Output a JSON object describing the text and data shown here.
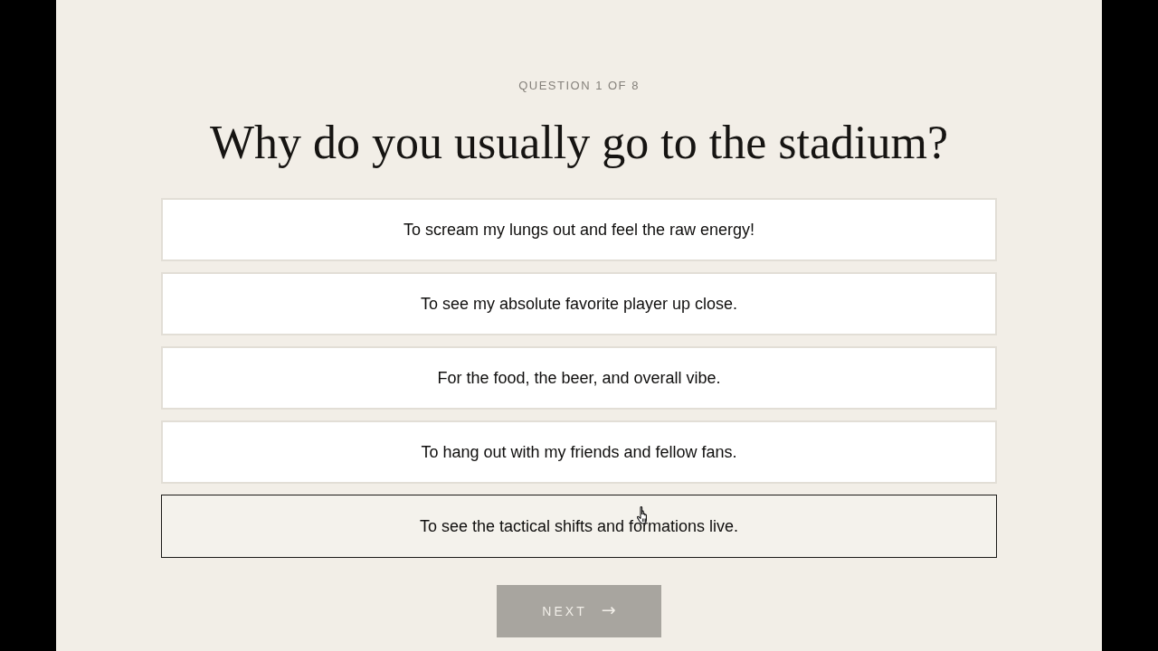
{
  "header": {
    "label": "QUESTION 1 OF 8"
  },
  "question": {
    "title": "Why do you usually go to the stadium?"
  },
  "options": [
    {
      "label": "To scream my lungs out and feel the raw energy!",
      "selected": false,
      "hovered": false
    },
    {
      "label": "To see my absolute favorite player up close.",
      "selected": false,
      "hovered": false
    },
    {
      "label": "For the food, the beer, and overall vibe.",
      "selected": false,
      "hovered": false
    },
    {
      "label": "To hang out with my friends and fellow fans.",
      "selected": false,
      "hovered": false
    },
    {
      "label": "To see the tactical shifts and formations live.",
      "selected": false,
      "hovered": true
    }
  ],
  "next_button": {
    "label": "NEXT",
    "arrow": "→",
    "disabled": true
  }
}
